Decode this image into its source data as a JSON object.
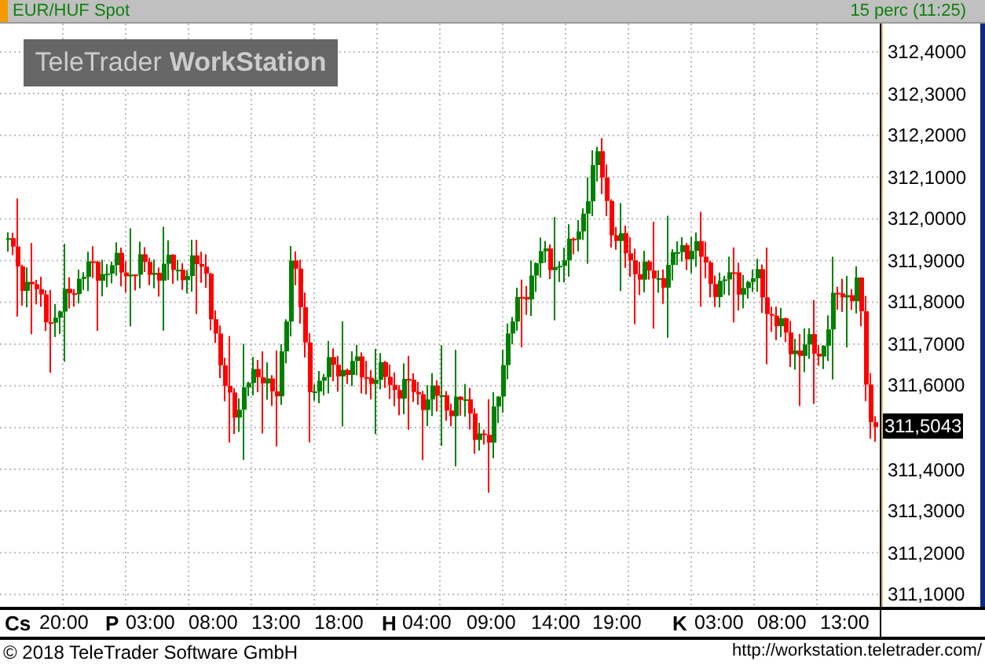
{
  "header": {
    "instrument": "EUR/HUF Spot",
    "interval": "15 perc (11:25)"
  },
  "logo": {
    "brand": "TeleTrader",
    "product": "WorkStation"
  },
  "y_axis": {
    "ticks_above_last": [
      "312,4000",
      "312,3000",
      "312,2000",
      "312,1000",
      "312,0000",
      "311,9000",
      "311,8000",
      "311,7000",
      "311,6000"
    ],
    "ticks_below_last": [
      "311,4000",
      "311,3000",
      "311,2000",
      "311,1000"
    ],
    "last_price": "311,5043"
  },
  "x_axis": {
    "labels": [
      {
        "text": "Cs",
        "kind": "day"
      },
      {
        "text": "20:00",
        "kind": "time"
      },
      {
        "text": "P",
        "kind": "day"
      },
      {
        "text": "03:00",
        "kind": "time"
      },
      {
        "text": "08:00",
        "kind": "time"
      },
      {
        "text": "13:00",
        "kind": "time"
      },
      {
        "text": "18:00",
        "kind": "time"
      },
      {
        "text": "H",
        "kind": "day"
      },
      {
        "text": "04:00",
        "kind": "time"
      },
      {
        "text": "09:00",
        "kind": "time"
      },
      {
        "text": "14:00",
        "kind": "time"
      },
      {
        "text": "19:00",
        "kind": "time"
      },
      {
        "text": "K",
        "kind": "day"
      },
      {
        "text": "03:00",
        "kind": "time"
      },
      {
        "text": "08:00",
        "kind": "time"
      },
      {
        "text": "13:00",
        "kind": "time"
      }
    ]
  },
  "footer": {
    "copyright": "© 2018 TeleTrader Software GmbH",
    "url": "http://workstation.teletrader.com/"
  }
}
